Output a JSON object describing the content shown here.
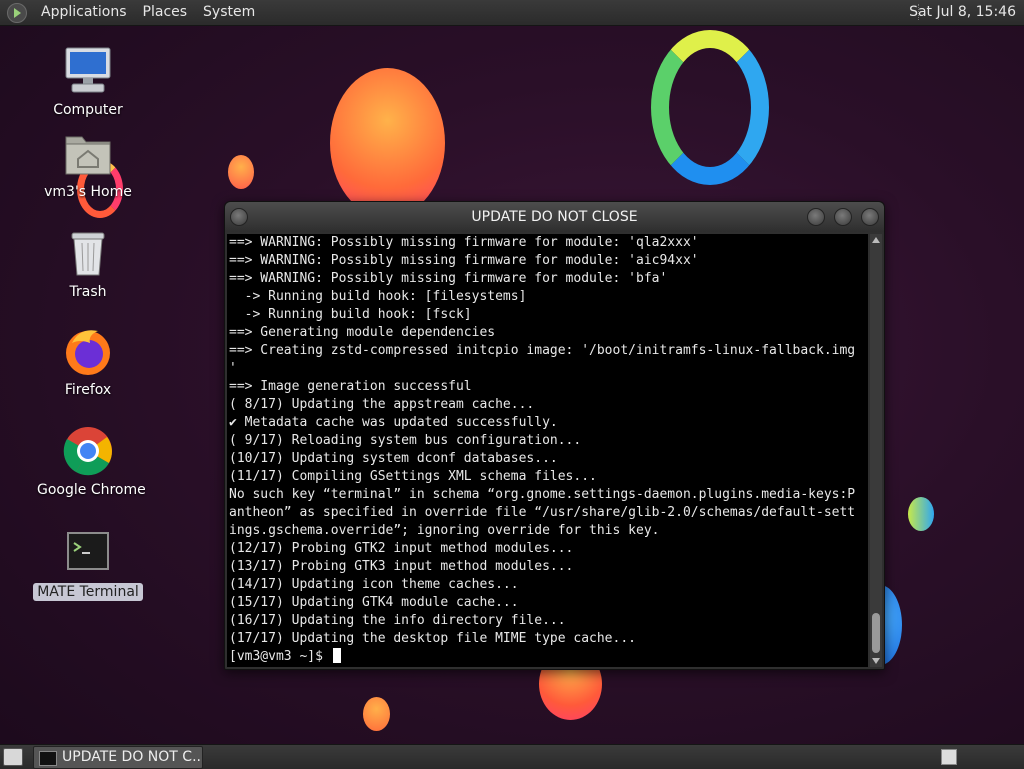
{
  "top_panel": {
    "menus": [
      "Applications",
      "Places",
      "System"
    ],
    "clock": "Sat Jul  8, 15:46"
  },
  "desktop": {
    "icons": [
      {
        "label": "Computer",
        "icon": "computer-icon"
      },
      {
        "label": "vm3's Home",
        "icon": "home-folder-icon"
      },
      {
        "label": "Trash",
        "icon": "trash-icon"
      },
      {
        "label": "Firefox",
        "icon": "firefox-icon"
      },
      {
        "label": "Google Chrome",
        "icon": "chrome-icon"
      },
      {
        "label": "MATE Terminal",
        "icon": "terminal-icon"
      }
    ]
  },
  "terminal_window": {
    "title": "UPDATE DO NOT CLOSE",
    "lines": [
      "==> WARNING: Possibly missing firmware for module: 'qla2xxx'",
      "==> WARNING: Possibly missing firmware for module: 'aic94xx'",
      "==> WARNING: Possibly missing firmware for module: 'bfa'",
      "  -> Running build hook: [filesystems]",
      "  -> Running build hook: [fsck]",
      "==> Generating module dependencies",
      "==> Creating zstd-compressed initcpio image: '/boot/initramfs-linux-fallback.img",
      "'",
      "==> Image generation successful",
      "( 8/17) Updating the appstream cache...",
      "✔ Metadata cache was updated successfully.",
      "( 9/17) Reloading system bus configuration...",
      "(10/17) Updating system dconf databases...",
      "(11/17) Compiling GSettings XML schema files...",
      "No such key “terminal” in schema “org.gnome.settings-daemon.plugins.media-keys:P",
      "antheon” as specified in override file “/usr/share/glib-2.0/schemas/default-sett",
      "ings.gschema.override”; ignoring override for this key.",
      "(12/17) Probing GTK2 input method modules...",
      "(13/17) Probing GTK3 input method modules...",
      "(14/17) Updating icon theme caches...",
      "(15/17) Updating GTK4 module cache...",
      "(16/17) Updating the info directory file...",
      "(17/17) Updating the desktop file MIME type cache..."
    ],
    "prompt": "[vm3@vm3 ~]$ "
  },
  "bottom_panel": {
    "task_label": "UPDATE DO NOT C..."
  }
}
